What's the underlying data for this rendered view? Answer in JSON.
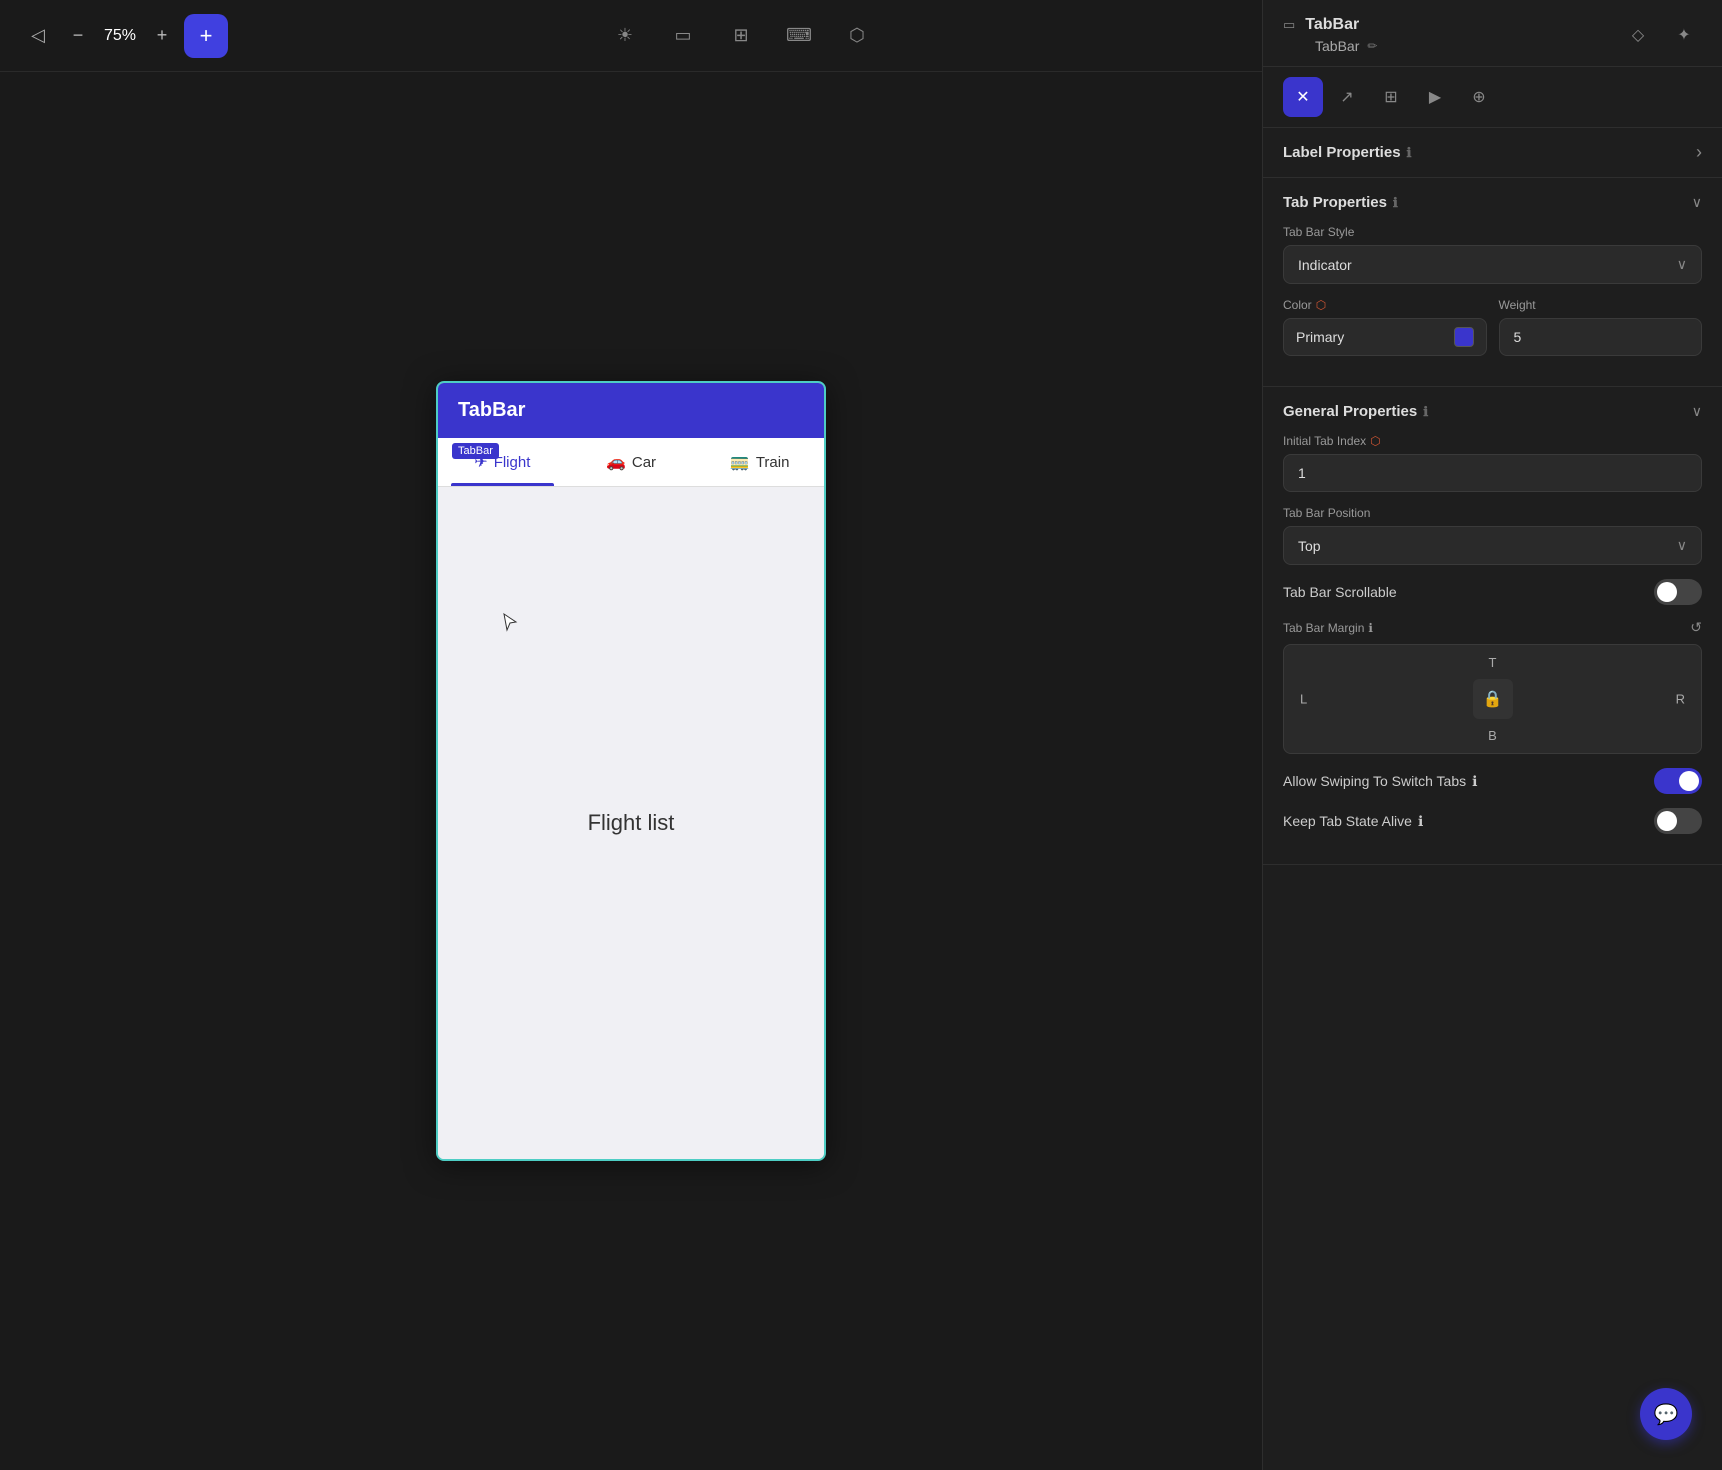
{
  "toolbar": {
    "zoom_value": "75%",
    "collapse_icon": "◁",
    "minus_icon": "−",
    "plus_icon": "+",
    "add_icon": "✦",
    "sun_icon": "☀",
    "phone_icon": "▭",
    "grid_icon": "⊞",
    "keyboard_icon": "⌨",
    "connect_icon": "⬡"
  },
  "canvas": {
    "mobile_header_title": "TabBar",
    "tabbar_badge": "TabBar",
    "tabs": [
      {
        "label": "Flight",
        "icon": "✈",
        "active": true
      },
      {
        "label": "Car",
        "icon": "🚗",
        "active": false
      },
      {
        "label": "Train",
        "icon": "🚃",
        "active": false
      }
    ],
    "content_text": "Flight list"
  },
  "right_panel": {
    "component_name": "TabBar",
    "instance_name": "TabBar",
    "edit_icon": "✏",
    "header_icons": [
      {
        "name": "gem",
        "icon": "◇"
      },
      {
        "name": "add-component",
        "icon": "✦"
      }
    ],
    "tabs": [
      {
        "label": "design",
        "icon": "✕",
        "active": true
      },
      {
        "label": "event",
        "icon": "↗"
      },
      {
        "label": "table",
        "icon": "⊞"
      },
      {
        "label": "play",
        "icon": "▶"
      },
      {
        "label": "clone",
        "icon": "⊕"
      }
    ],
    "label_properties": {
      "title": "Label Properties",
      "info_icon": "ℹ",
      "arrow": "›"
    },
    "tab_properties": {
      "title": "Tab Properties",
      "info_icon": "ℹ",
      "tab_bar_style_label": "Tab Bar Style",
      "tab_bar_style_value": "Indicator",
      "color_label": "Color",
      "color_icon": "⬡",
      "color_value": "Primary",
      "color_swatch": "#3a35cc",
      "weight_label": "Weight",
      "weight_value": "5"
    },
    "general_properties": {
      "title": "General Properties",
      "info_icon": "ℹ",
      "initial_tab_index_label": "Initial Tab Index",
      "initial_tab_index_icon": "⬡",
      "initial_tab_index_value": "1",
      "tab_bar_position_label": "Tab Bar Position",
      "tab_bar_position_value": "Top",
      "tab_bar_scrollable_label": "Tab Bar Scrollable",
      "tab_bar_scrollable_on": false,
      "tab_bar_margin_label": "Tab Bar Margin",
      "margin_t": "T",
      "margin_b": "B",
      "margin_l": "L",
      "margin_r": "R",
      "lock_icon": "🔒",
      "allow_swiping_label": "Allow Swiping To Switch Tabs",
      "allow_swiping_info": "ℹ",
      "allow_swiping_on": true,
      "keep_tab_state_label": "Keep Tab State Alive",
      "keep_tab_state_info": "ℹ",
      "keep_tab_state_on": false
    }
  }
}
